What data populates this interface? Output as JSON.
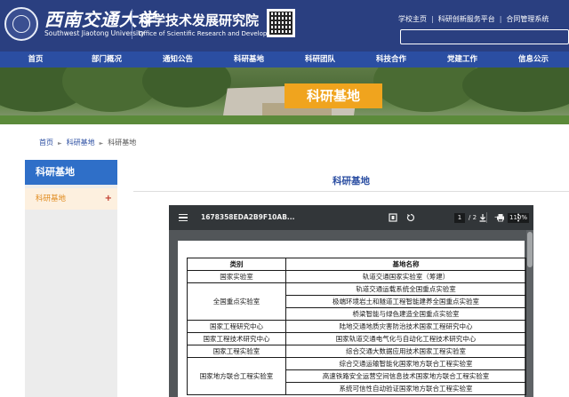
{
  "header": {
    "university_cn": "西南交通大学",
    "university_en": "Southwest Jiaotong University",
    "office_cn": "科学技术发展研究院",
    "office_en": "Office of Scientific Research and Development",
    "top_links": [
      "学校主页",
      "科研创新服务平台",
      "合同管理系统"
    ],
    "separator": "|"
  },
  "nav": {
    "items": [
      "首页",
      "部门概况",
      "通知公告",
      "科研基地",
      "科研团队",
      "科技合作",
      "党建工作",
      "信息公示"
    ]
  },
  "banner": {
    "label": "科研基地"
  },
  "breadcrumb": {
    "items": [
      "首页",
      "科研基地",
      "科研基地"
    ],
    "arrow": "►"
  },
  "sidebar": {
    "heading": "科研基地",
    "items": [
      {
        "label": "科研基地",
        "expand": "+"
      }
    ]
  },
  "content": {
    "title": "科研基地"
  },
  "pdf_viewer": {
    "file_name": "1678358EDA2B9F10AB...",
    "current_page": "1",
    "total_pages": "/ 2",
    "zoom_minus": "—",
    "zoom": "110%",
    "zoom_plus": "+",
    "icons": [
      "menu-icon",
      "fit-page-icon",
      "rotate-icon",
      "download-icon",
      "print-icon",
      "more-icon"
    ]
  },
  "table": {
    "headers": [
      "类别",
      "基地名称"
    ],
    "rows": [
      {
        "category": "国家实验室",
        "rowspan": 1,
        "names": [
          "轨道交通国家实验室（筹建）"
        ]
      },
      {
        "category": "全国重点实验室",
        "rowspan": 3,
        "names": [
          "轨道交通运载系统全国重点实验室",
          "极端环境岩土和隧道工程智能建养全国重点实验室",
          "桥梁智能与绿色建造全国重点实验室"
        ]
      },
      {
        "category": "国家工程研究中心",
        "rowspan": 1,
        "names": [
          "陆地交通地质灾害防治技术国家工程研究中心"
        ]
      },
      {
        "category": "国家工程技术研究中心",
        "rowspan": 1,
        "names": [
          "国家轨道交通电气化与自动化工程技术研究中心"
        ]
      },
      {
        "category": "国家工程实验室",
        "rowspan": 1,
        "names": [
          "综合交通大数据应用技术国家工程实验室"
        ]
      },
      {
        "category": "国家地方联合工程实验室",
        "rowspan": 3,
        "names": [
          "综合交通运输智能化国家地方联合工程实验室",
          "高速铁路安全运营空间信息技术国家地方联合工程实验室",
          "系统可信性自动验证国家地方联合工程实验室"
        ]
      }
    ]
  },
  "colors": {
    "header_bg": "#2a3f80",
    "nav_bg": "#2b4ea2",
    "accent_orange": "#f0a41e",
    "sidebar_head": "#2f6fc8",
    "sidebar_active": "#e08a1c"
  }
}
